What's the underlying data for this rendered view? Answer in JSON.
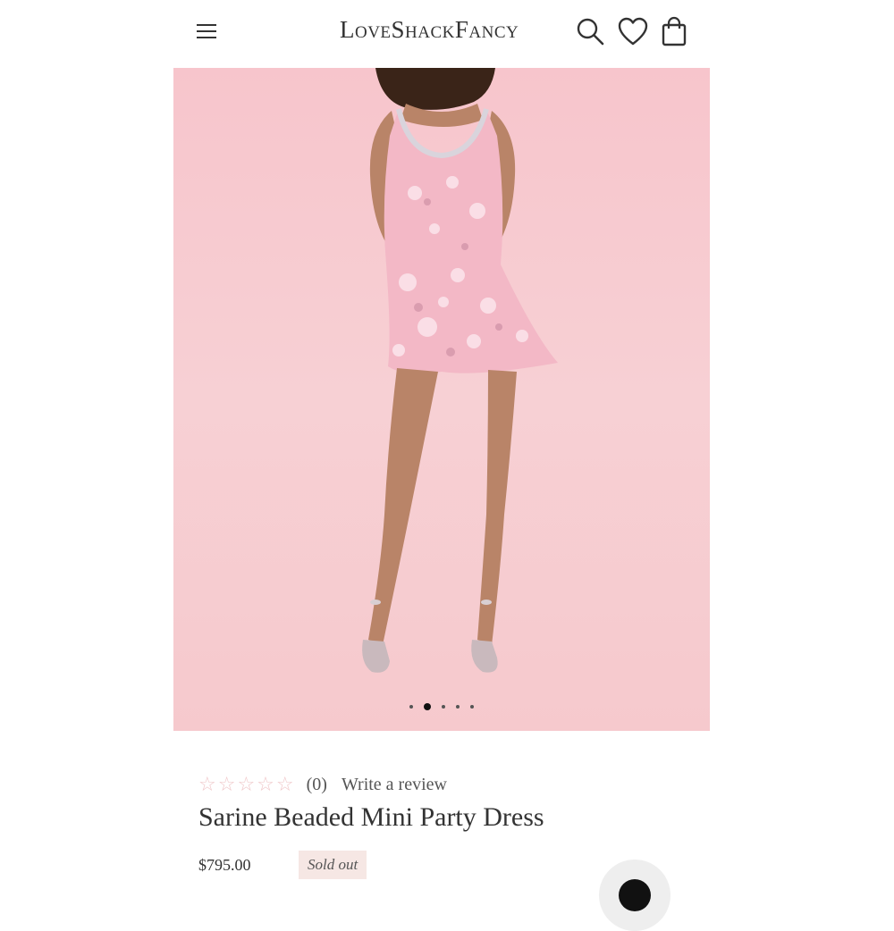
{
  "header": {
    "logo": "LoveShackFancy",
    "menu_icon": "hamburger-menu-icon",
    "search_icon": "search-icon",
    "wishlist_icon": "heart-icon",
    "bag_icon": "shopping-bag-icon"
  },
  "gallery": {
    "slides": 5,
    "active_slide": 2,
    "background": "#f7c8cd"
  },
  "product": {
    "rating": {
      "stars": "☆☆☆☆☆",
      "filled": 0,
      "max": 5,
      "count": "(0)",
      "review_link": "Write a review"
    },
    "name": "Sarine Beaded Mini Party Dress",
    "price": "$795.00",
    "status": "Sold out"
  },
  "colors": {
    "star": "#f0c6c8",
    "badge_bg": "#f6e7e4",
    "text": "#333333"
  }
}
